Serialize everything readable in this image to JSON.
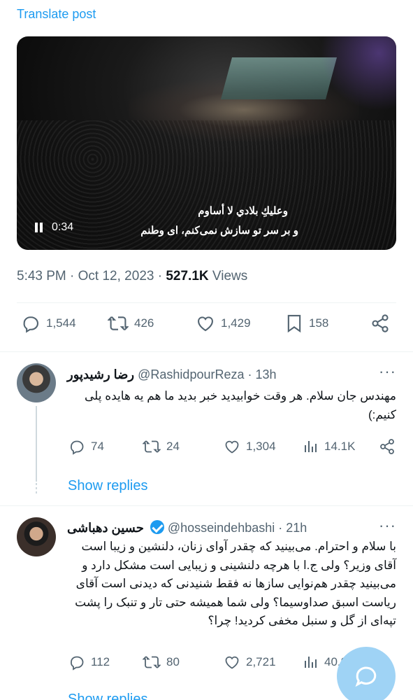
{
  "translate": "Translate post",
  "video": {
    "subtitle_arabic": "وعليكِ بلادي لا أساوم",
    "subtitle_persian": "و بر سر تو سازش نمی‌کنم، ای وطنم",
    "timestamp": "0:34"
  },
  "post_meta": {
    "time": "5:43 PM",
    "dot": "·",
    "date": "Oct 12, 2023",
    "dot2": "·",
    "views": "527.1K",
    "views_label": "Views"
  },
  "actions": {
    "replies": "1,544",
    "reposts": "426",
    "likes": "1,429",
    "bookmarks": "158"
  },
  "replies": [
    {
      "name": "رضا رشیدپور",
      "handle": "@RashidpourReza",
      "time": "· 13h",
      "text": "مهندس جان سلام. هر وقت خوابیدید خبر بدید ما هم یه هایده پلی کنیم:)",
      "reply_count": "74",
      "repost_count": "24",
      "like_count": "1,304",
      "view_count": "14.1K",
      "show_replies": "Show replies"
    },
    {
      "name": "حسین دهباشی",
      "handle": "@hosseindehbashi",
      "time": "· 21h",
      "text": "با سلام و احترام. می‌بینید که چقدر آوای زنان، دلنشین و زیبا است آقای وزیر؟ ولی ج.ا با هرچه دلنشینی و زیبایی است مشکل دارد و می‌بینید چقدر هم‌نوایی سازها نه فقط شنیدنی که دیدنی است آقای ریاست اسبق صداوسیما؟ ولی شما همیشه حتی تار و تنبک را پشت تپه‌ای از گل و سنبل مخفی کردید! چرا؟",
      "reply_count": "112",
      "repost_count": "80",
      "like_count": "2,721",
      "view_count": "40.9K",
      "show_replies": "Show replies"
    }
  ],
  "colors": {
    "accent": "#1d9bf0",
    "text": "#0f1419",
    "muted": "#536471"
  }
}
